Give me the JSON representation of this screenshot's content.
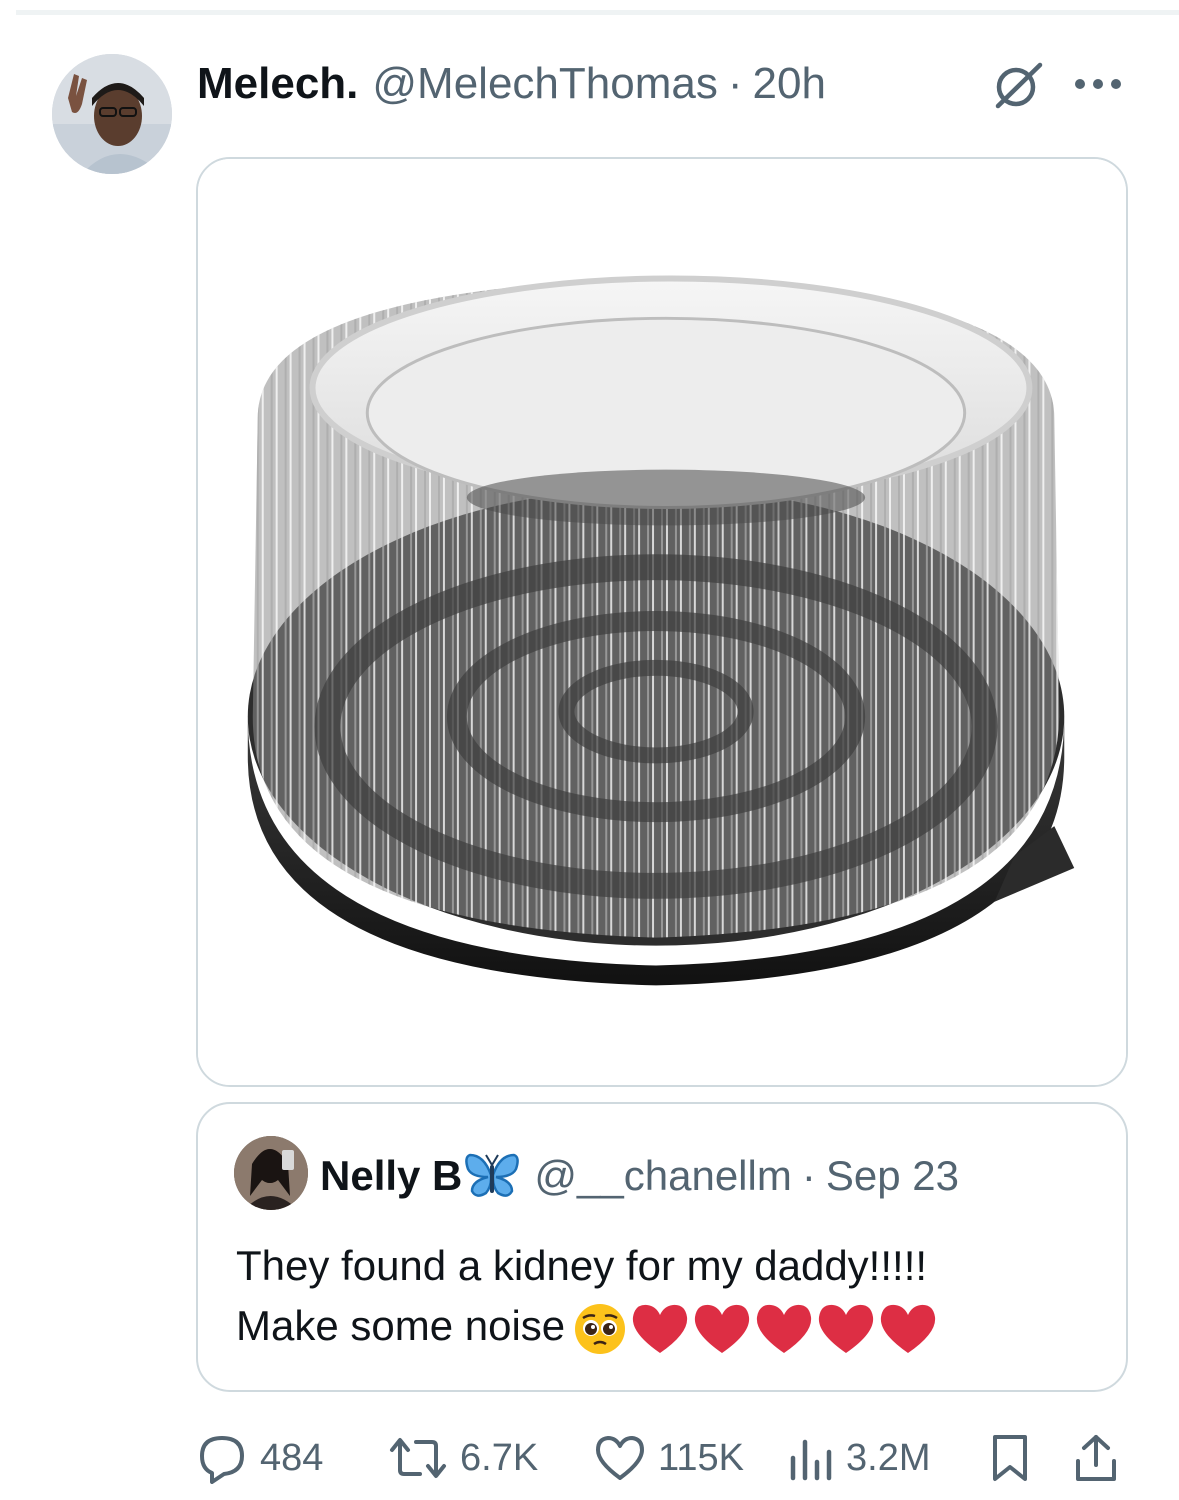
{
  "tweet": {
    "display_name": "Melech.",
    "handle": "@MelechThomas",
    "separator": "·",
    "time": "20h"
  },
  "quote": {
    "display_name": "Nelly B",
    "handle": "@__chanellm",
    "separator": "·",
    "date": "Sep 23",
    "text_line1": "They found a kidney for my daddy!!!!!",
    "text_line2": "Make some noise",
    "emojis": [
      "pleading-face",
      "red-heart",
      "red-heart",
      "red-heart",
      "red-heart",
      "red-heart"
    ]
  },
  "actions": {
    "replies": "484",
    "reposts": "6.7K",
    "likes": "115K",
    "views": "3.2M"
  },
  "icons": {
    "grok": "grok-icon",
    "more": "more-dots-icon",
    "reply": "reply-icon",
    "repost": "repost-icon",
    "like": "heart-icon",
    "views": "views-chart-icon",
    "bookmark": "bookmark-icon",
    "share": "share-icon"
  },
  "colors": {
    "secondary_text": "#536471",
    "border": "#cfd9de",
    "heart_red": "#dd2e44",
    "butterfly_blue": "#3b88c3"
  }
}
